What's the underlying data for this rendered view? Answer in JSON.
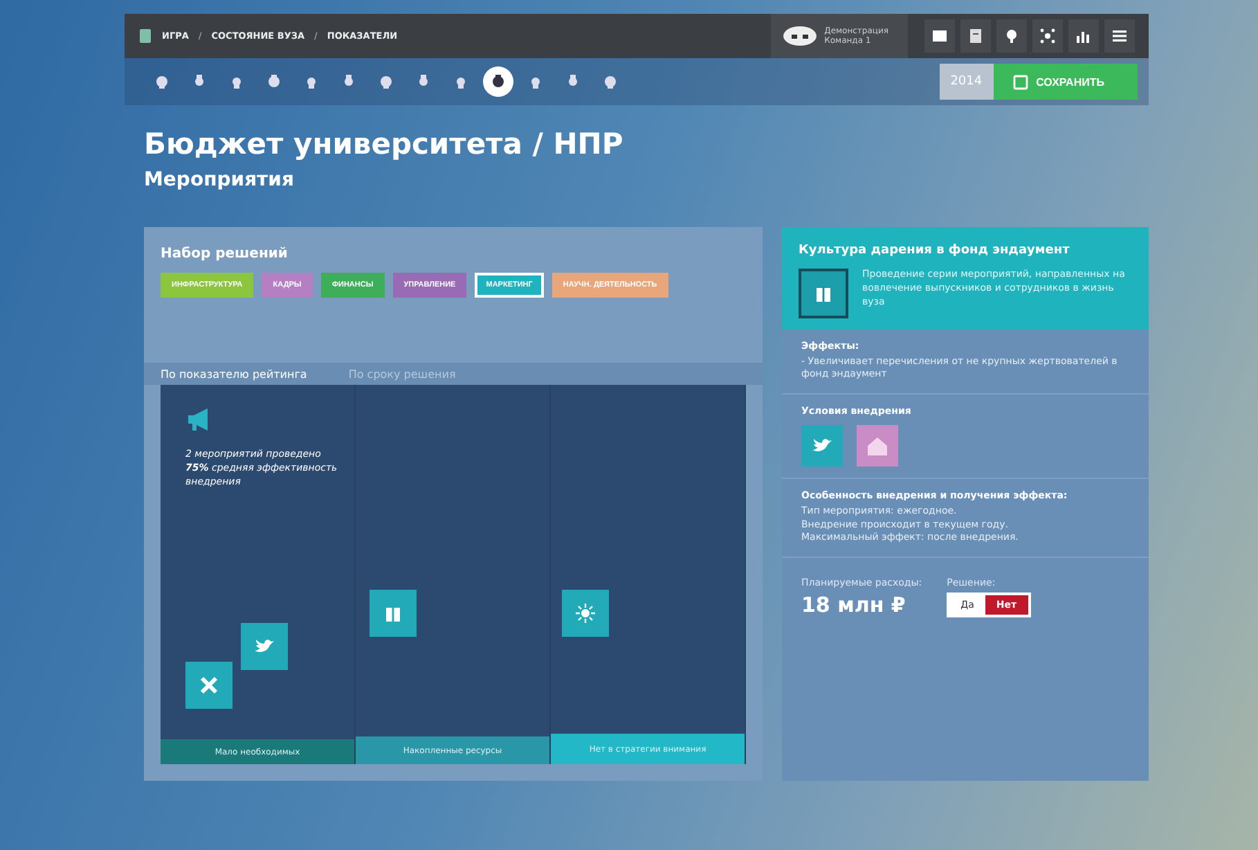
{
  "breadcrumb": [
    "ИГРА",
    "СОСТОЯНИЕ ВУЗА",
    "ПОКАЗАТЕЛИ"
  ],
  "breadcrumb_separator": "/",
  "user": {
    "name": "Демонстрация",
    "team": "Команда 1"
  },
  "toolbar": [
    {
      "selected": false
    },
    {
      "selected": false
    },
    {
      "selected": false
    },
    {
      "selected": false
    },
    {
      "selected": false
    },
    {
      "selected": false
    },
    {
      "selected": false
    },
    {
      "selected": false
    },
    {
      "selected": false
    },
    {
      "selected": true
    },
    {
      "selected": false
    },
    {
      "selected": false
    },
    {
      "selected": false
    }
  ],
  "year": "2014",
  "save_button": "СОХРАНИТЬ",
  "title": "Бюджет университета / НПР",
  "subtitle": "Мероприятия",
  "decision_set": {
    "heading": "Набор решений",
    "tags": [
      {
        "label": "ИНФРАСТРУКТУРА",
        "color": "#8cc63f",
        "selected": false
      },
      {
        "label": "КАДРЫ",
        "color": "#b57fc4",
        "selected": false
      },
      {
        "label": "ФИНАНСЫ",
        "color": "#3fae5a",
        "selected": false
      },
      {
        "label": "УПРАВЛЕНИЕ",
        "color": "#9a6bb5",
        "selected": false
      },
      {
        "label": "МАРКЕТИНГ",
        "color": "#1fb3c0",
        "selected": true
      },
      {
        "label": "НАУЧН. ДЕЯТЕЛЬНОСТЬ",
        "color": "#e8a67a",
        "selected": false
      }
    ]
  },
  "view_tabs": [
    {
      "label": "По показателю рейтинга",
      "selected": true
    },
    {
      "label": "По сроку решения",
      "selected": false
    }
  ],
  "summary": "2 мероприятий проведено\n**75%** средняя эффективность внедрения",
  "columns": [
    {
      "label": "Мало необходимых",
      "color": "#1a7a7a"
    },
    {
      "label": "Накопленные ресурсы",
      "color": "#2a97a8"
    },
    {
      "label": "Нет в стратегии внимания",
      "color": "#22b8c8"
    }
  ],
  "detail": {
    "title": "Культура дарения в фонд эндаумент",
    "description": "Проведение серии мероприятий, направленных на вовлечение выпускников и сотрудников в жизнь вуза",
    "effects_heading": "Эффекты:",
    "effects": "- Увеличивает перечисления от не крупных жертвователей в фонд эндаумент",
    "conditions_heading": "Условия внедрения",
    "features_heading": "Особенность внедрения и получения эффекта:",
    "features": [
      "Тип мероприятия: ежегодное.",
      "Внедрение происходит в текущем году.",
      "Максимальный эффект: после внедрения."
    ],
    "cost_label": "Планируемые расходы:",
    "cost": "18 млн ₽",
    "decision_label": "Решение:",
    "decision": [
      {
        "label": "Да",
        "selected": false
      },
      {
        "label": "Нет",
        "selected": true
      }
    ]
  }
}
